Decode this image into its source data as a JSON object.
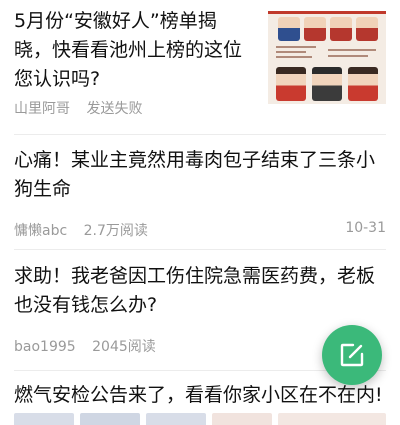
{
  "feed": {
    "items": [
      {
        "title": "5月份“安徽好人”榜单揭晓，快看看池州上榜的这位您认识吗?",
        "author": "山里阿哥",
        "status": "发送失败",
        "thumbnail_icon": "award-poster-thumbnail"
      },
      {
        "title": "心痛！某业主竟然用毒肉包子结束了三条小狗生命",
        "author": "慵懒abc",
        "reads": "2.7万阅读",
        "date": "10-31"
      },
      {
        "title": "求助！我老爸因工伤住院急需医药费，老板也没有钱怎么办?",
        "author": "bao1995",
        "reads": "2045阅读"
      },
      {
        "title": "燃气安检公告来了，看看你家小区在不在内!"
      }
    ]
  },
  "compose_button": {
    "icon": "compose-icon",
    "color": "#3bb97a"
  }
}
